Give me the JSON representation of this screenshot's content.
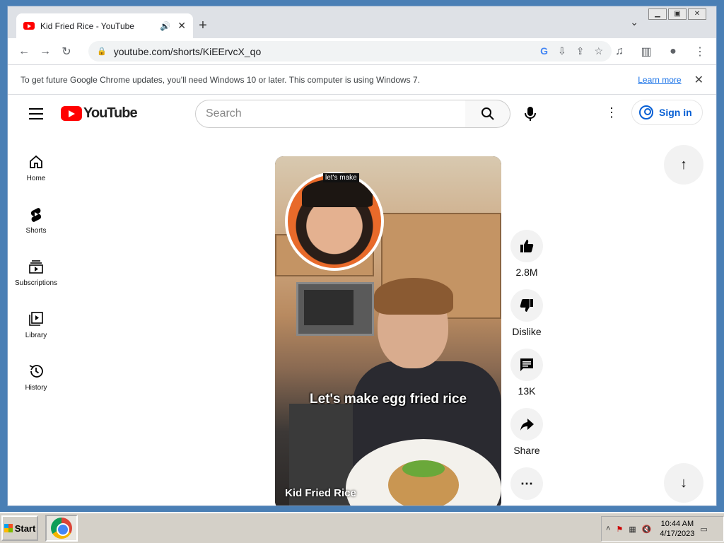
{
  "browser": {
    "tab_title": "Kid Fried Rice - YouTube",
    "new_tab_symbol": "+",
    "url": "youtube.com/shorts/KiEErvcX_qo"
  },
  "infobar": {
    "message": "To get future Google Chrome updates, you'll need Windows 10 or later. This computer is using Windows 7.",
    "link_label": "Learn more"
  },
  "youtube": {
    "logo_text": "YouTube",
    "search_placeholder": "Search",
    "signin_label": "Sign in",
    "nav": [
      {
        "label": "Home",
        "icon": "home-icon"
      },
      {
        "label": "Shorts",
        "icon": "shorts-icon"
      },
      {
        "label": "Subscriptions",
        "icon": "subscriptions-icon"
      },
      {
        "label": "Library",
        "icon": "library-icon"
      },
      {
        "label": "History",
        "icon": "history-icon"
      }
    ],
    "video": {
      "bubble_caption": "let's make",
      "overlay_caption": "Let's make egg fried rice",
      "title": "Kid Fried Rice"
    },
    "actions": {
      "like_count": "2.8M",
      "dislike_label": "Dislike",
      "comment_count": "13K",
      "share_label": "Share"
    }
  },
  "taskbar": {
    "start_label": "Start",
    "time": "10:44 AM",
    "date": "4/17/2023"
  },
  "colors": {
    "youtube_red": "#ff0000",
    "link_blue": "#065fd4"
  }
}
